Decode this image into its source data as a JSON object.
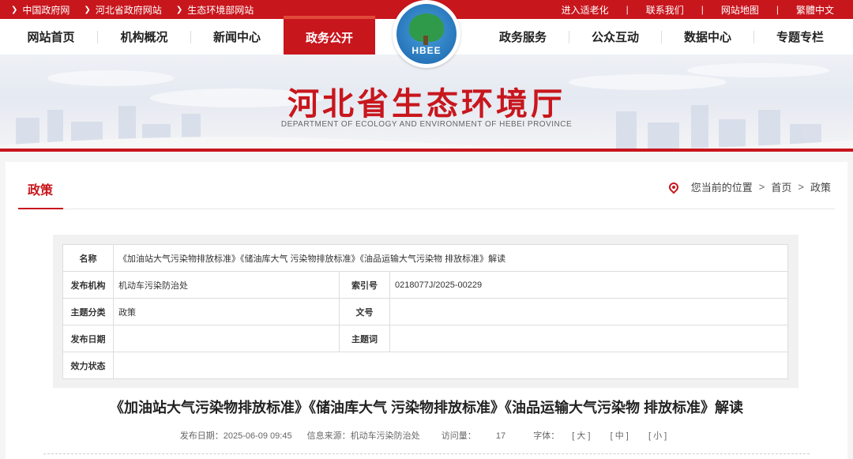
{
  "topbar": {
    "crumbs": [
      "中国政府网",
      "河北省政府网站",
      "生态环境部网站"
    ],
    "links": [
      "进入适老化",
      "联系我们",
      "网站地图",
      "繁體中文"
    ],
    "separator": "|"
  },
  "nav": {
    "items": [
      "网站首页",
      "机构概况",
      "新闻中心",
      "政务公开",
      "政务服务",
      "公众互动",
      "数据中心",
      "专题专栏"
    ],
    "active": "政务公开"
  },
  "logo": {
    "text": "HBEE"
  },
  "banner": {
    "title": "河北省生态环境厅",
    "subtitle": "DEPARTMENT OF ECOLOGY AND ENVIRONMENT OF HEBEI PROVINCE"
  },
  "section": {
    "title": "政策",
    "location_label": "您当前的位置",
    "breadcrumb": [
      "首页",
      "政策"
    ]
  },
  "meta": {
    "name_label": "名称",
    "name_value": "《加油站大气污染物排放标准》《储油库大气 污染物排放标准》《油品运输大气污染物 排放标准》解读",
    "org_label": "发布机构",
    "org_value": "机动车污染防治处",
    "index_label": "索引号",
    "index_value": "0218077J/2025-00229",
    "category_label": "主题分类",
    "category_value": "政策",
    "docno_label": "文号",
    "docno_value": "",
    "date_label": "发布日期",
    "date_value": "",
    "keyword_label": "主题词",
    "keyword_value": "",
    "status_label": "效力状态",
    "status_value": ""
  },
  "doc": {
    "title": "《加油站大气污染物排放标准》《储油库大气 污染物排放标准》《油品运输大气污染物 排放标准》解读",
    "publish_date": "发布日期：2025-06-09 09:45",
    "source": "信息来源：机动车污染防治处",
    "views_label": "访问量：",
    "views": "17",
    "font_label": "字体：",
    "font_large": "[ 大 ]",
    "font_medium": "[ 中 ]",
    "font_small": "[ 小 ]"
  },
  "colors": {
    "brand_red": "#c8161d"
  }
}
